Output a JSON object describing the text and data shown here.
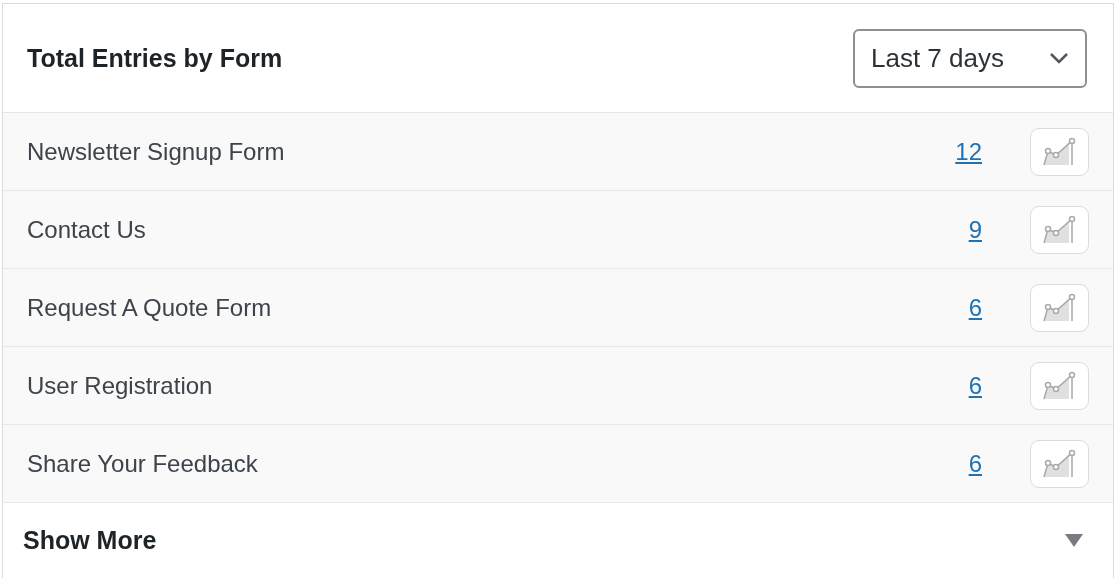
{
  "header": {
    "title": "Total Entries by Form",
    "period": {
      "value": "Last 7 days"
    }
  },
  "rows": [
    {
      "name": "Newsletter Signup Form",
      "count": "12"
    },
    {
      "name": "Contact Us",
      "count": "9"
    },
    {
      "name": "Request A Quote Form",
      "count": "6"
    },
    {
      "name": "User Registration",
      "count": "6"
    },
    {
      "name": "Share Your Feedback",
      "count": "6"
    }
  ],
  "footer": {
    "label": "Show More"
  }
}
